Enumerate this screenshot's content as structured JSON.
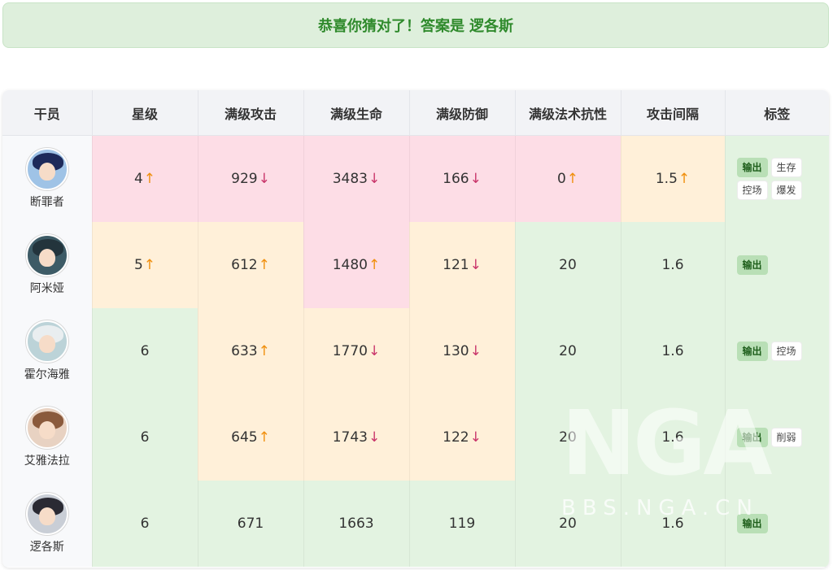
{
  "banner": {
    "message": "恭喜你猜对了！答案是",
    "answer": "逻各斯",
    "color": "#2f8a2c"
  },
  "table": {
    "headers": [
      "干员",
      "星级",
      "满级攻击",
      "满级生命",
      "满级防御",
      "满级法术抗性",
      "攻击间隔",
      "标签"
    ],
    "rows": [
      {
        "name": "断罪者",
        "avatar": "avatar-dark-blue-hair",
        "star": "4",
        "star_hint": "↑",
        "star_state": "pink",
        "atk": "929",
        "atk_hint": "↓",
        "atk_state": "pink",
        "hp": "3483",
        "hp_hint": "↓",
        "hp_state": "pink",
        "def": "166",
        "def_hint": "↓",
        "def_state": "pink",
        "res": "0",
        "res_hint": "↑",
        "res_state": "pink",
        "interval": "1.5",
        "interval_hint": "↑",
        "interval_state": "yellow",
        "tags": [
          "输出",
          "生存",
          "控场",
          "爆发"
        ]
      },
      {
        "name": "阿米娅",
        "avatar": "avatar-hooded",
        "star": "5",
        "star_hint": "↑",
        "star_state": "yellow",
        "atk": "612",
        "atk_hint": "↑",
        "atk_state": "yellow",
        "hp": "1480",
        "hp_hint": "↑",
        "hp_state": "pink",
        "def": "121",
        "def_hint": "↓",
        "def_state": "yellow",
        "res": "20",
        "res_hint": "",
        "res_state": "green",
        "interval": "1.6",
        "interval_hint": "",
        "interval_state": "green",
        "tags": [
          "输出"
        ]
      },
      {
        "name": "霍尔海雅",
        "avatar": "avatar-white-hair",
        "star": "6",
        "star_hint": "",
        "star_state": "green",
        "atk": "633",
        "atk_hint": "↑",
        "atk_state": "yellow",
        "hp": "1770",
        "hp_hint": "↓",
        "hp_state": "yellow",
        "def": "130",
        "def_hint": "↓",
        "def_state": "yellow",
        "res": "20",
        "res_hint": "",
        "res_state": "green",
        "interval": "1.6",
        "interval_hint": "",
        "interval_state": "green",
        "tags": [
          "输出",
          "控场"
        ]
      },
      {
        "name": "艾雅法拉",
        "avatar": "avatar-brown-hair",
        "star": "6",
        "star_hint": "",
        "star_state": "green",
        "atk": "645",
        "atk_hint": "↑",
        "atk_state": "yellow",
        "hp": "1743",
        "hp_hint": "↓",
        "hp_state": "yellow",
        "def": "122",
        "def_hint": "↓",
        "def_state": "yellow",
        "res": "20",
        "res_hint": "",
        "res_state": "green",
        "interval": "1.6",
        "interval_hint": "",
        "interval_state": "green",
        "tags": [
          "输出",
          "削弱"
        ]
      },
      {
        "name": "逻各斯",
        "avatar": "avatar-black-hair",
        "star": "6",
        "star_hint": "",
        "star_state": "green",
        "atk": "671",
        "atk_hint": "",
        "atk_state": "green",
        "hp": "1663",
        "hp_hint": "",
        "hp_state": "green",
        "def": "119",
        "def_hint": "",
        "def_state": "green",
        "res": "20",
        "res_hint": "",
        "res_state": "green",
        "interval": "1.6",
        "interval_hint": "",
        "interval_state": "green",
        "tags": [
          "输出"
        ]
      }
    ]
  },
  "colors": {
    "pink": "#fddde6",
    "yellow": "#fff0d9",
    "green": "#e3f3e1",
    "arrow_up": "#f0900f",
    "arrow_down": "#c9356a",
    "tag_primary": "#b9dfb6"
  },
  "watermark": {
    "logo": "NGA",
    "site": "BBS.NGA.CN"
  }
}
